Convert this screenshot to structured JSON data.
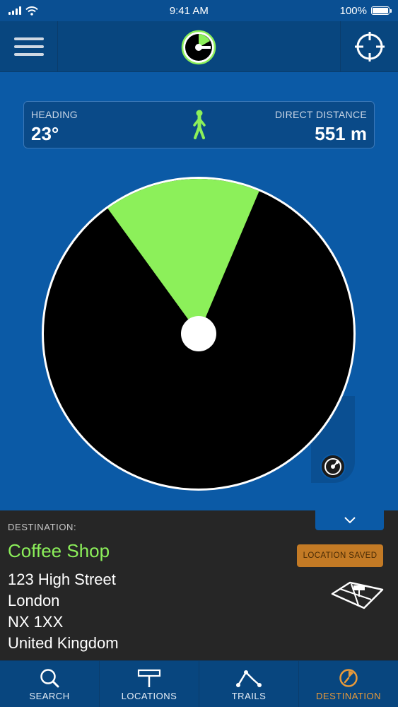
{
  "status_bar": {
    "time": "9:41 AM",
    "battery": "100%"
  },
  "info": {
    "heading_label": "HEADING",
    "heading_value": "23°",
    "distance_label": "DIRECT DISTANCE",
    "distance_value": "551 m"
  },
  "radar": {
    "heading_degrees": 23,
    "sector_color": "#8cf05a"
  },
  "destination": {
    "label": "DESTINATION:",
    "name": "Coffee Shop",
    "address_line1": "123 High Street",
    "address_line2": "London",
    "address_line3": "NX 1XX",
    "address_line4": "United Kingdom",
    "saved_label": "LOCATION SAVED"
  },
  "tabs": [
    {
      "label": "SEARCH",
      "icon": "search-icon"
    },
    {
      "label": "LOCATIONS",
      "icon": "signpost-icon"
    },
    {
      "label": "TRAILS",
      "icon": "trail-icon"
    },
    {
      "label": "DESTINATION",
      "icon": "compass-icon",
      "active": true
    }
  ],
  "colors": {
    "accent_green": "#8cf05a",
    "accent_orange": "#e99a3a",
    "background_blue": "#0b5aa6"
  }
}
